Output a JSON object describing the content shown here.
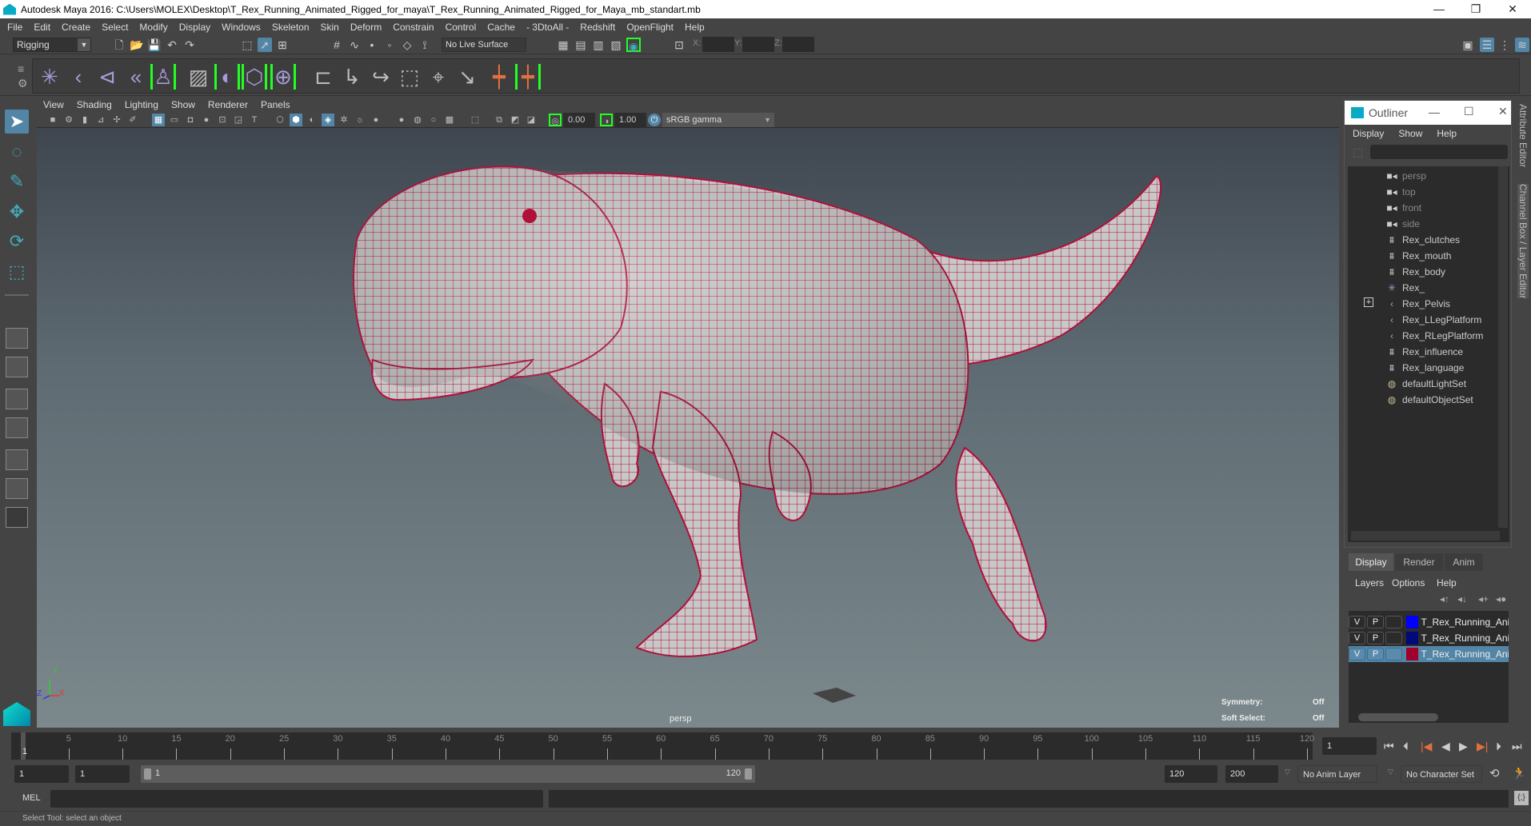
{
  "window": {
    "title": "Autodesk Maya 2016: C:\\Users\\MOLEX\\Desktop\\T_Rex_Running_Animated_Rigged_for_maya\\T_Rex_Running_Animated_Rigged_for_Maya_mb_standart.mb",
    "minimize": "—",
    "restore": "❐",
    "close": "✕"
  },
  "menubar": [
    "File",
    "Edit",
    "Create",
    "Select",
    "Modify",
    "Display",
    "Windows",
    "Skeleton",
    "Skin",
    "Deform",
    "Constrain",
    "Control",
    "Cache",
    "- 3DtoAll -",
    "Redshift",
    "OpenFlight",
    "Help"
  ],
  "status_line": {
    "mode": "Rigging",
    "live_surface": "No Live Surface",
    "x_label": "X:",
    "y_label": "Y:",
    "z_label": "Z:"
  },
  "viewport": {
    "menu": [
      "View",
      "Shading",
      "Lighting",
      "Show",
      "Renderer",
      "Panels"
    ],
    "near_value": "0.00",
    "far_value": "1.00",
    "color_space": "sRGB gamma",
    "camera_label": "persp",
    "symmetry_label": "Symmetry:",
    "symmetry_value": "Off",
    "soft_select_label": "Soft Select:",
    "soft_select_value": "Off",
    "axis": {
      "x": "X",
      "y": "Y",
      "z": "Z"
    },
    "wire_color": "#b0103a"
  },
  "outliner": {
    "title": "Outliner",
    "menu": [
      "Display",
      "Show",
      "Help"
    ],
    "items": [
      {
        "label": "persp",
        "icon": "camera-icon",
        "type": "camera"
      },
      {
        "label": "top",
        "icon": "camera-icon",
        "type": "camera"
      },
      {
        "label": "front",
        "icon": "camera-icon",
        "type": "camera"
      },
      {
        "label": "side",
        "icon": "camera-icon",
        "type": "camera"
      },
      {
        "label": "Rex_clutches",
        "icon": "mesh-icon",
        "type": "mesh"
      },
      {
        "label": "Rex_mouth",
        "icon": "mesh-icon",
        "type": "mesh"
      },
      {
        "label": "Rex_body",
        "icon": "mesh-icon",
        "type": "mesh"
      },
      {
        "label": "Rex_",
        "icon": "locator-icon",
        "type": "locator"
      },
      {
        "label": "Rex_Pelvis",
        "icon": "joint-icon",
        "type": "joint",
        "expandable": true
      },
      {
        "label": "Rex_LLegPlatform",
        "icon": "joint-icon",
        "type": "joint"
      },
      {
        "label": "Rex_RLegPlatform",
        "icon": "joint-icon",
        "type": "joint"
      },
      {
        "label": "Rex_influence",
        "icon": "mesh-icon",
        "type": "mesh"
      },
      {
        "label": "Rex_language",
        "icon": "mesh-icon",
        "type": "mesh"
      },
      {
        "label": "defaultLightSet",
        "icon": "set-icon",
        "type": "set"
      },
      {
        "label": "defaultObjectSet",
        "icon": "set-icon",
        "type": "set"
      }
    ]
  },
  "side_tabs": {
    "attribute_editor": "Attribute Editor",
    "channel_box": "Channel Box / Layer Editor"
  },
  "layer_editor": {
    "tabs": [
      "Display",
      "Render",
      "Anim"
    ],
    "active_tab": "Display",
    "menu": [
      "Layers",
      "Options",
      "Help"
    ],
    "layers": [
      {
        "v": "V",
        "p": "P",
        "color": "#0000ff",
        "name": "T_Rex_Running_Animated",
        "selected": false
      },
      {
        "v": "V",
        "p": "P",
        "color": "#000a7a",
        "name": "T_Rex_Running_Animated",
        "selected": false
      },
      {
        "v": "V",
        "p": "P",
        "color": "#a0002a",
        "name": "T_Rex_Running_Animated",
        "selected": true
      }
    ]
  },
  "timeline": {
    "ticks": [
      "5",
      "10",
      "15",
      "20",
      "25",
      "30",
      "35",
      "40",
      "45",
      "50",
      "55",
      "60",
      "65",
      "70",
      "75",
      "80",
      "85",
      "90",
      "95",
      "100",
      "105",
      "110",
      "115",
      "120"
    ],
    "current_frame_label": "1",
    "current_frame": "1",
    "range_start": 1,
    "range_end": 120
  },
  "range": {
    "start_time": "1",
    "playback_start": "1",
    "slider_start": "1",
    "slider_end": "120",
    "playback_end": "120",
    "end_time": "200",
    "anim_layer": "No Anim Layer",
    "character_set": "No Character Set"
  },
  "command_line": {
    "label": "MEL",
    "value": ""
  },
  "status_bar": {
    "help_text": "Select Tool: select an object"
  }
}
